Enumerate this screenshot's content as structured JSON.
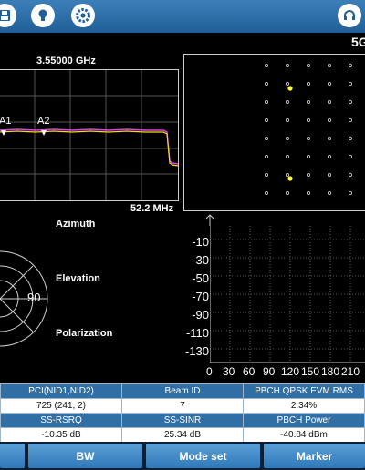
{
  "header": {
    "buttons": [
      "save-icon",
      "bulb-icon",
      "gear-icon",
      "headset-icon"
    ],
    "right_label": "5G"
  },
  "spectrum": {
    "center_freq": "3.55000 GHz",
    "span": "52.2 MHz",
    "markers": [
      "A1",
      "A2"
    ]
  },
  "beam": {
    "labels": [
      "Azimuth",
      "Elevation",
      "Polarization"
    ],
    "polar_label": "90"
  },
  "evm_plot": {
    "y_ticks": [
      "-10",
      "-30",
      "-50",
      "-70",
      "-90",
      "-110",
      "-130"
    ],
    "x_ticks": [
      "0",
      "30",
      "60",
      "90",
      "120",
      "150",
      "180",
      "210"
    ]
  },
  "table": {
    "row1_headers": [
      "PCI(NID1,NID2)",
      "Beam ID",
      "PBCH QPSK EVM RMS"
    ],
    "row1_values": [
      "725 (241, 2)",
      "7",
      "2.34%"
    ],
    "row2_headers": [
      "SS-RSRQ",
      "SS-SINR",
      "PBCH Power"
    ],
    "row2_values": [
      "-10.35 dB",
      "25.34 dB",
      "-40.84 dBm"
    ]
  },
  "softkeys": [
    "",
    "BW",
    "Mode set",
    "Marker"
  ],
  "colors": {
    "bar": "#2a6eaa",
    "trace_magenta": "#e040e0",
    "trace_yellow": "#f0e020",
    "constellation_point": "#ffff33"
  }
}
